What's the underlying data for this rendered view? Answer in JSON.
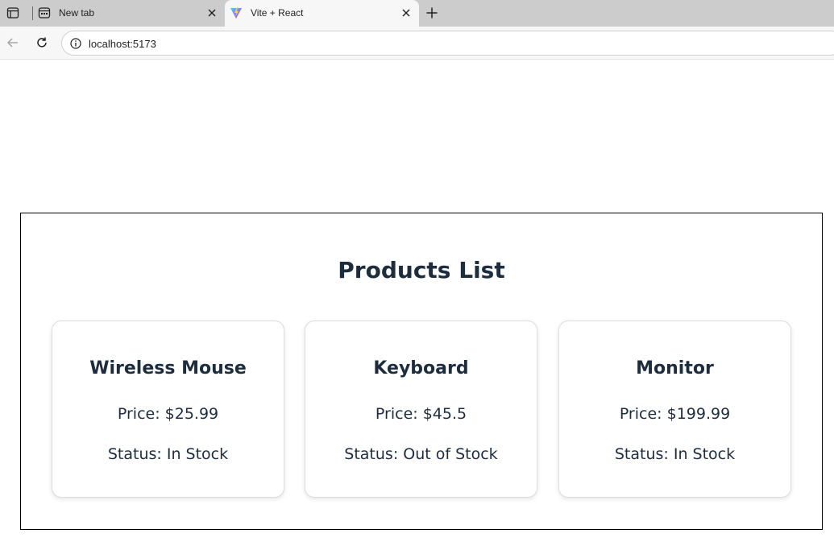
{
  "browser": {
    "tabs": [
      {
        "title": "New tab",
        "icon": "newtab-page-icon",
        "active": false
      },
      {
        "title": "Vite + React",
        "icon": "vite-logo-icon",
        "active": true
      }
    ],
    "address_bar": {
      "url": "localhost:5173"
    }
  },
  "page": {
    "title": "Products List",
    "products": [
      {
        "name": "Wireless Mouse",
        "price": "Price: $25.99",
        "status": "Status: In Stock"
      },
      {
        "name": "Keyboard",
        "price": "Price: $45.5",
        "status": "Status: Out of Stock"
      },
      {
        "name": "Monitor",
        "price": "Price: $199.99",
        "status": "Status: In Stock"
      }
    ]
  },
  "colors": {
    "tabstrip_bg": "#cccccc",
    "toolbar_bg": "#f7f7f7",
    "text_primary": "#1e2d3d",
    "card_border": "#dcdcdc"
  }
}
